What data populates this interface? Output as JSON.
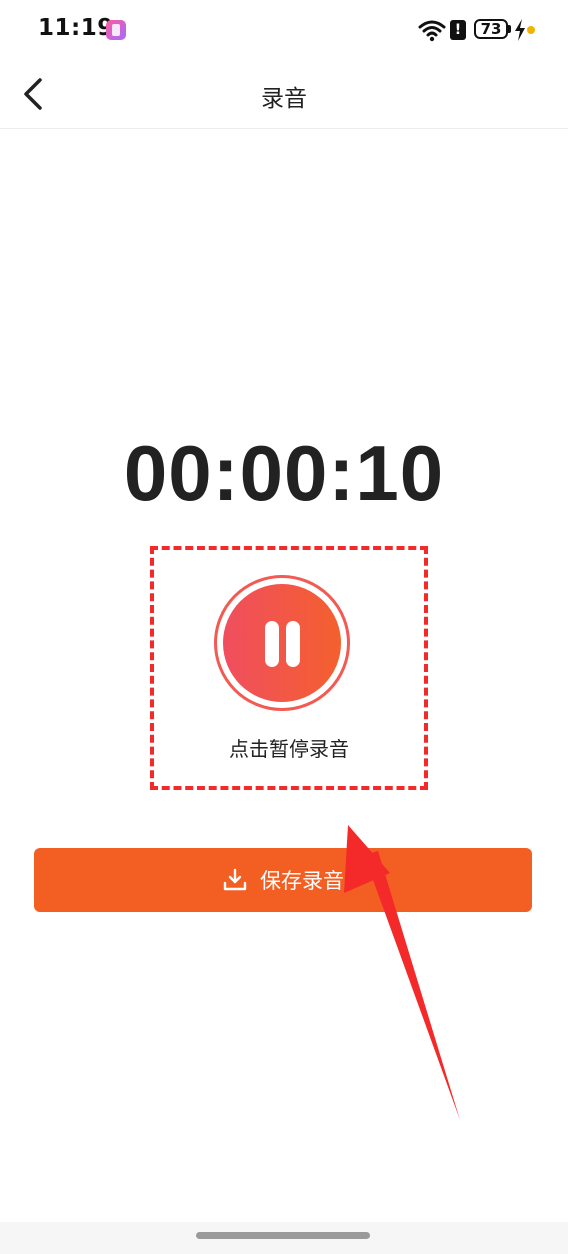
{
  "status_bar": {
    "time": "11:19",
    "battery_level": "73",
    "icons": [
      "app-icon",
      "wifi-icon",
      "alert-icon",
      "battery-icon",
      "charging-icon",
      "notification-dot"
    ]
  },
  "nav": {
    "title": "录音",
    "back_icon": "chevron-left-icon"
  },
  "recorder": {
    "elapsed": "00:00:10",
    "pause_hint": "点击暂停录音",
    "pause_icon": "pause-icon"
  },
  "actions": {
    "save_label": "保存录音",
    "save_icon": "download-icon"
  },
  "colors": {
    "accent": "#f35f22",
    "pause_gradient_start": "#f04e5f",
    "pause_gradient_end": "#f4602e",
    "annotation": "#f42a2a"
  }
}
